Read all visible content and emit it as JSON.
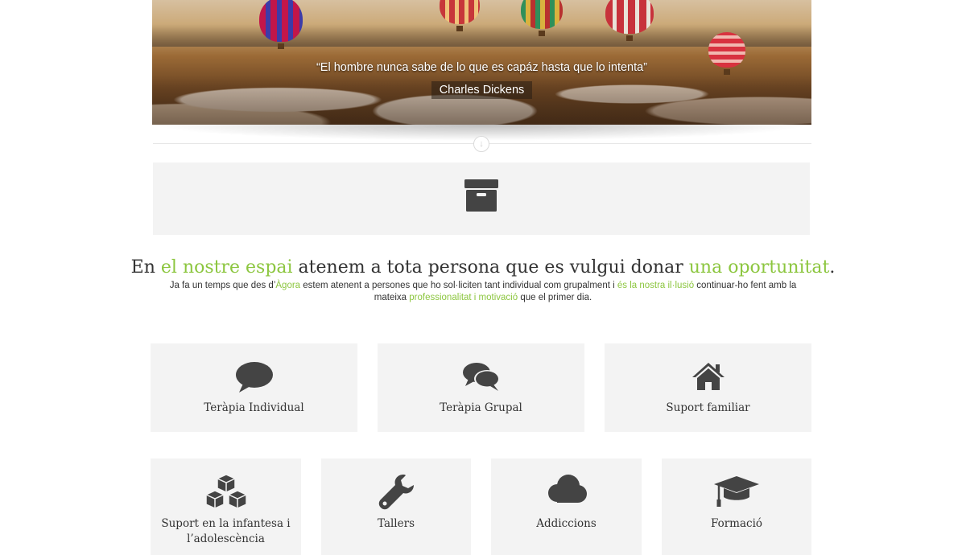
{
  "hero": {
    "quote": "“El hombre nunca sabe de lo que es capáz hasta que lo intenta”",
    "author": "Charles Dickens"
  },
  "archive": {
    "icon": "archive-icon"
  },
  "intro": {
    "headline": {
      "p1": "En ",
      "g1": "el nostre espai",
      "p2": " atenem a tota persona que es vulgui donar ",
      "g2": "una oportunitat",
      "p3": "."
    },
    "description": {
      "p1": "Ja fa un temps que des d’",
      "g1": "Àgora",
      "p2": " estem atenent a persones que ho sol·liciten tant individual com grupalment i ",
      "g2": "és la nostra il·lusió",
      "p3": " continuar-ho fent amb la mateixa ",
      "g3": "professionalitat i motivació",
      "p4": " que el primer dia."
    },
    "accent_color": "#8cc63f"
  },
  "services": [
    {
      "label": "Teràpia Individual",
      "icon": "speech-bubble-icon"
    },
    {
      "label": "Teràpia Grupal",
      "icon": "chat-bubbles-icon"
    },
    {
      "label": "Suport familiar",
      "icon": "home-icon"
    },
    {
      "label": "Suport en la infantesa i l’adolescència",
      "icon": "cubes-icon"
    },
    {
      "label": "Tallers",
      "icon": "wrench-icon"
    },
    {
      "label": "Addiccions",
      "icon": "cloud-icon"
    },
    {
      "label": "Formació",
      "icon": "graduation-cap-icon"
    }
  ]
}
